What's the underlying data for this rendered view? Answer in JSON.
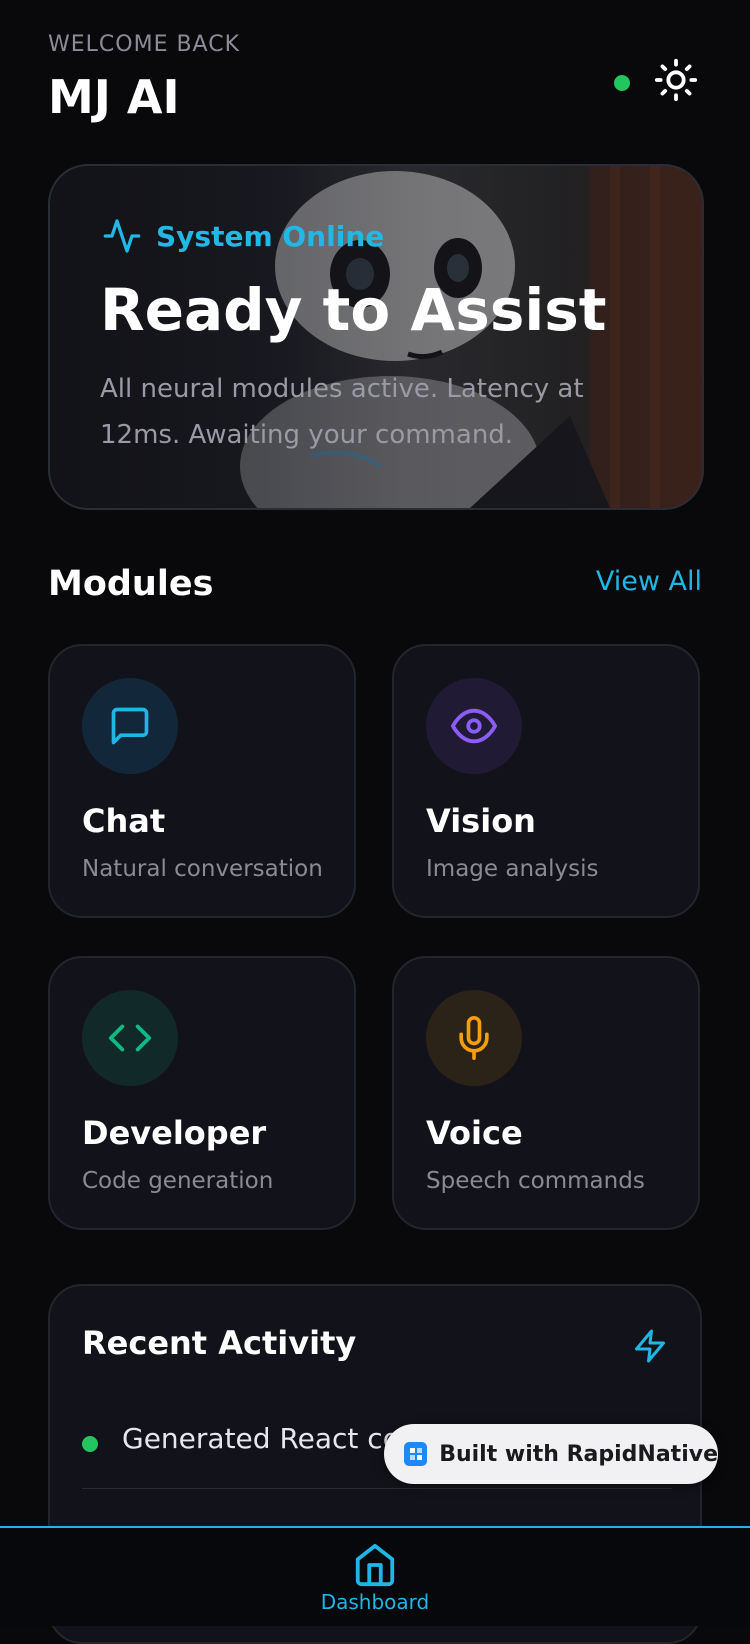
{
  "header": {
    "welcome": "WELCOME BACK",
    "title": "MJ AI",
    "status_color": "#22c55e",
    "theme_icon": "sun-icon"
  },
  "hero": {
    "status_label": "System Online",
    "status_icon": "activity-icon",
    "title": "Ready to Assist",
    "description": "All neural modules active. Latency at 12ms. Awaiting your command.",
    "accent": "#22b8e6"
  },
  "modules": {
    "title": "Modules",
    "view_all": "View All",
    "items": [
      {
        "title": "Chat",
        "subtitle": "Natural conversation",
        "icon": "message-square-icon",
        "color": "#1fb6e6"
      },
      {
        "title": "Vision",
        "subtitle": "Image analysis",
        "icon": "eye-icon",
        "color": "#8b5cf6"
      },
      {
        "title": "Developer",
        "subtitle": "Code generation",
        "icon": "code-icon",
        "color": "#10b981"
      },
      {
        "title": "Voice",
        "subtitle": "Speech commands",
        "icon": "mic-icon",
        "color": "#f59e0b"
      }
    ]
  },
  "activity": {
    "title": "Recent Activity",
    "icon": "zap-icon",
    "items": [
      {
        "text": "Generated React con",
        "status_color": "#22c55e"
      }
    ]
  },
  "badge": {
    "label": "Built with RapidNative"
  },
  "nav": {
    "items": [
      {
        "label": "Dashboard",
        "icon": "home-icon",
        "active": true
      }
    ]
  }
}
